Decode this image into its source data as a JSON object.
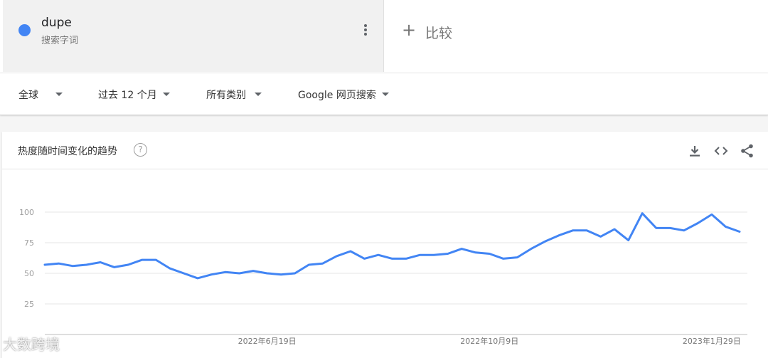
{
  "search_term": {
    "name": "dupe",
    "type": "搜索字词",
    "color": "#4285f4"
  },
  "compare": {
    "plus": "+",
    "label": "比较"
  },
  "filters": {
    "region": "全球",
    "time": "过去 12 个月",
    "category": "所有类别",
    "property": "Google 网页搜索"
  },
  "card": {
    "title": "热度随时间变化的趋势",
    "help": "?"
  },
  "watermark": "大数跨境",
  "chart_data": {
    "type": "line",
    "title": "热度随时间变化的趋势",
    "xlabel": "",
    "ylabel": "",
    "ylim": [
      0,
      100
    ],
    "yticks": [
      25,
      50,
      75,
      100
    ],
    "x_tick_labels": [
      "2022年6月19日",
      "2022年10月9日",
      "2023年1月29日"
    ],
    "x_tick_indices": [
      16,
      32,
      48
    ],
    "grid": true,
    "legend": "none",
    "series": [
      {
        "color": "#4285f4",
        "values": [
          57,
          58,
          56,
          57,
          59,
          55,
          57,
          61,
          61,
          54,
          50,
          46,
          49,
          51,
          50,
          52,
          50,
          49,
          50,
          57,
          58,
          64,
          68,
          62,
          65,
          62,
          62,
          65,
          65,
          66,
          70,
          67,
          66,
          62,
          63,
          70,
          76,
          81,
          85,
          85,
          80,
          86,
          77,
          99,
          87,
          87,
          85,
          91,
          98,
          88,
          84
        ]
      }
    ]
  }
}
